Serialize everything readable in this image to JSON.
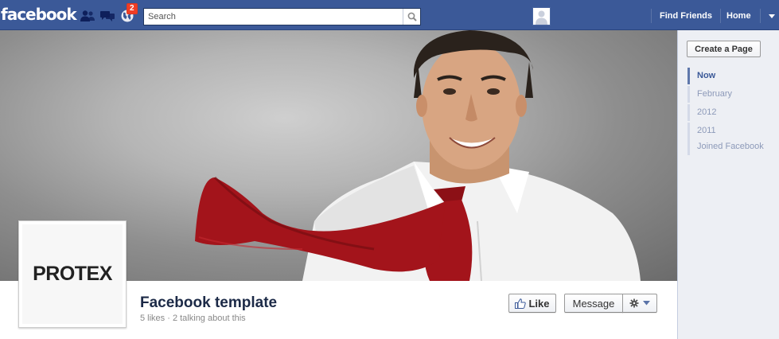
{
  "topbar": {
    "logo": "facebook",
    "notifications_count": "2",
    "search_placeholder": "Search",
    "nav_find_friends": "Find Friends",
    "nav_home": "Home",
    "icons": [
      "friend-requests-icon",
      "messages-icon",
      "notifications-globe-icon",
      "search-icon",
      "account-menu-arrow-icon"
    ]
  },
  "cover": {
    "description_icon": "cover-photo"
  },
  "profile": {
    "picture_text": "PROTEX",
    "page_name": "Facebook template",
    "stats": "5 likes · 2 talking about this",
    "like_button": "Like",
    "message_button": "Message"
  },
  "rightcol": {
    "create_page": "Create a Page",
    "timeline": [
      {
        "label": "Now",
        "active": true
      },
      {
        "label": "February",
        "active": false
      },
      {
        "label": "2012",
        "active": false
      },
      {
        "label": "2011",
        "active": false
      },
      {
        "label": "Joined Facebook",
        "active": false
      }
    ]
  },
  "colors": {
    "brand": "#3b5998",
    "badge": "#f03d25",
    "tie": "#a3141b"
  }
}
